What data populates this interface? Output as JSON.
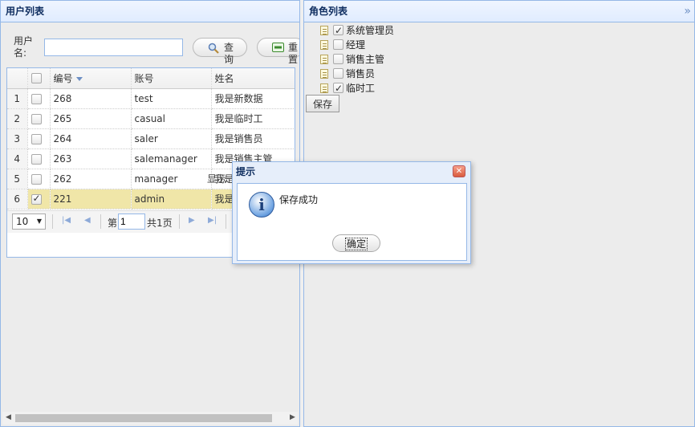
{
  "left_panel": {
    "title": "用户列表",
    "toolbar": {
      "username_label": "用户名:",
      "username_value": "",
      "search_label": "查询",
      "reset_label": "重置"
    },
    "grid": {
      "columns": [
        "编号",
        "账号",
        "姓名"
      ],
      "rows": [
        {
          "rownum": "1",
          "checked": false,
          "id": "268",
          "account": "test",
          "name": "我是新数据"
        },
        {
          "rownum": "2",
          "checked": false,
          "id": "265",
          "account": "casual",
          "name": "我是临时工"
        },
        {
          "rownum": "3",
          "checked": false,
          "id": "264",
          "account": "saler",
          "name": "我是销售员"
        },
        {
          "rownum": "4",
          "checked": false,
          "id": "263",
          "account": "salemanager",
          "name": "我是销售主管"
        },
        {
          "rownum": "5",
          "checked": false,
          "id": "262",
          "account": "manager",
          "name": "我是经理"
        },
        {
          "rownum": "6",
          "checked": true,
          "id": "221",
          "account": "admin",
          "name": "我是管理员"
        }
      ]
    },
    "pager": {
      "page_size": "10",
      "page_prefix": "第",
      "page_number": "1",
      "page_total": "共1页",
      "display_text": "显示"
    }
  },
  "right_panel": {
    "title": "角色列表",
    "roles": [
      {
        "label": "系统管理员",
        "checked": true
      },
      {
        "label": "经理",
        "checked": false
      },
      {
        "label": "销售主管",
        "checked": false
      },
      {
        "label": "销售员",
        "checked": false
      },
      {
        "label": "临时工",
        "checked": true
      }
    ],
    "save_label": "保存"
  },
  "dialog": {
    "title": "提示",
    "message": "保存成功",
    "ok_label": "确定",
    "icon": "info-icon"
  },
  "colors": {
    "header_border": "#95b8e7",
    "header_text": "#0e2d5f",
    "selected_row": "#ffe48d"
  }
}
